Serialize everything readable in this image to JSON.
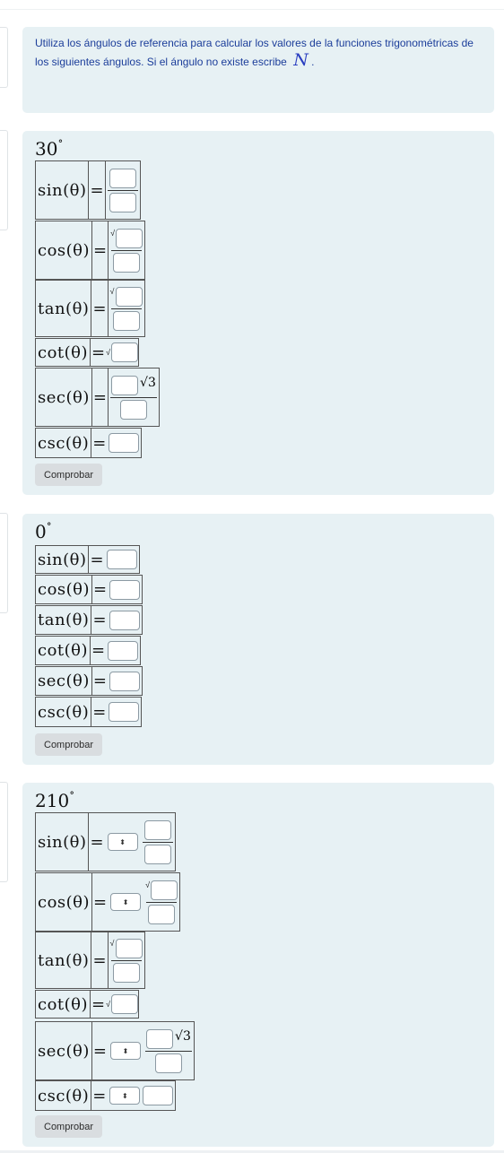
{
  "intro": {
    "text": "Utiliza los ángulos de referencia para calcular los valores de la funciones trigonométricas de los siguientes ángulos. Si el ángulo no existe escribe",
    "n_symbol": "N",
    "suffix": "."
  },
  "labels": {
    "sin": "sin(θ)",
    "cos": "cos(θ)",
    "tan": "tan(θ)",
    "cot": "cot(θ)",
    "sec": "sec(θ)",
    "csc": "csc(θ)",
    "eq": "=",
    "sqrt": "√",
    "root3": "√3",
    "degree": "∘",
    "select_arrow": "⬍"
  },
  "problems": [
    {
      "angle": "30",
      "button": "Comprobar"
    },
    {
      "angle": "0",
      "button": "Comprobar"
    },
    {
      "angle": "210",
      "button": "Comprobar"
    }
  ]
}
